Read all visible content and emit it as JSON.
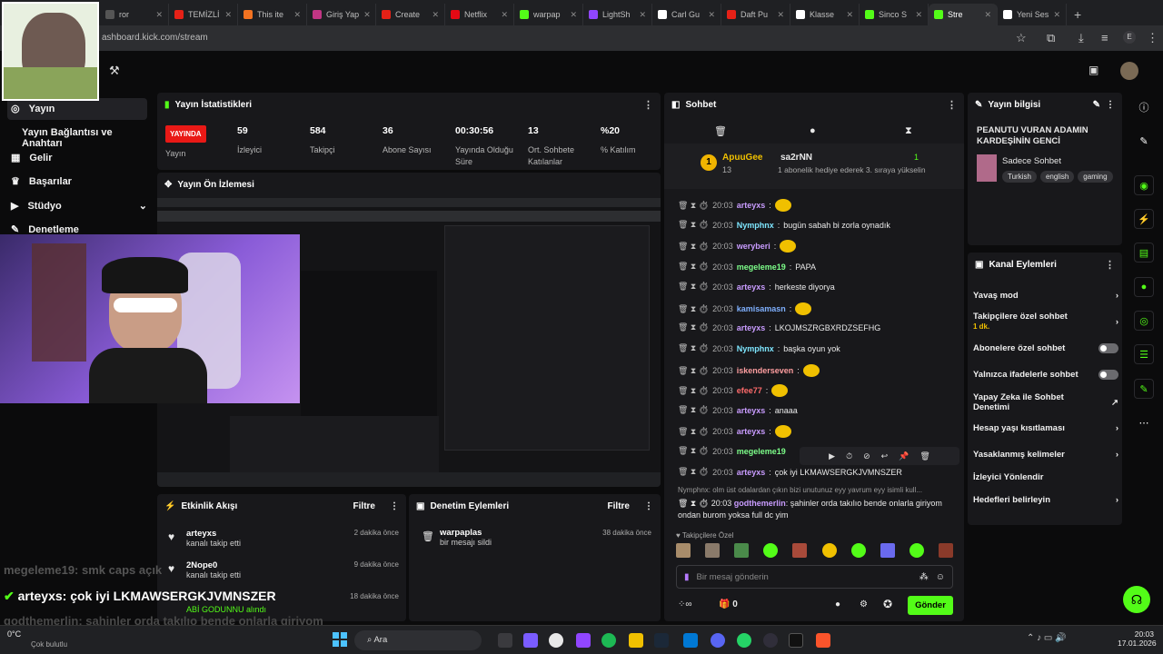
{
  "browser": {
    "tabs": [
      "ror",
      "TEMİZLİ",
      "This ite",
      "Giriş Yap",
      "Create",
      "Netflix",
      "warpap",
      "LightSh",
      "Carl Gu",
      "Daft Pu",
      "Klasse",
      "Sinco S",
      "Stre",
      "Yeni Ses"
    ],
    "url": "ashboard.kick.com/stream"
  },
  "nav": {
    "items": [
      "Yayın",
      "Yayın Bağlantısı ve Anahtarı",
      "Gelir",
      "Başarılar",
      "Stüdyo",
      "Denetleme"
    ]
  },
  "stats": {
    "title": "Yayın İstatistikleri",
    "live": "YAYINDA",
    "status": "Yayın",
    "viewers": "59",
    "viewers_label": "İzleyici",
    "followers": "584",
    "followers_label": "Takipçi",
    "subs": "36",
    "subs_label": "Abone Sayısı",
    "uptime": "00:30:56",
    "uptime_label": "Yayında Olduğu Süre",
    "avg": "13",
    "avg_label": "Ort. Sohbete Katılanlar",
    "pct": "%20",
    "pct_label": "% Katılım"
  },
  "preview": {
    "title": "Yayın Ön İzlemesi"
  },
  "activity": {
    "title": "Etkinlik Akışı",
    "filter": "Filtre",
    "items": [
      {
        "user": "arteyxs",
        "desc": "kanalı takip etti",
        "time": "2 dakika önce"
      },
      {
        "user": "2Nope0",
        "desc": "kanalı takip etti",
        "time": "9 dakika önce"
      },
      {
        "user": "",
        "desc": "ABİ GODUNNU alındı",
        "time": "18 dakika önce"
      }
    ]
  },
  "moderation": {
    "title": "Denetim Eylemleri",
    "filter": "Filtre",
    "user": "warpaplas",
    "desc": "bir mesajı sildi",
    "time": "38 dakika önce"
  },
  "chat": {
    "title": "Sohbet",
    "pinned_user": "ApuuGee",
    "pinned_count": "13",
    "gifter": "sa2rNN",
    "gift_count": "1",
    "gift_msg": "1 abonelik hediye ederek 3. sıraya yükselin",
    "messages": [
      {
        "time": "20:03",
        "user": "arteyxs",
        "text": "",
        "color": "#c99cff"
      },
      {
        "time": "20:03",
        "user": "Nymphnx",
        "text": "bugün sabah bi zorla oynadık",
        "color": "#7ee6ff"
      },
      {
        "time": "20:03",
        "user": "weryberi",
        "text": "",
        "color": "#c99cff"
      },
      {
        "time": "20:03",
        "user": "megeleme19",
        "text": "PAPA",
        "color": "#7dff8a"
      },
      {
        "time": "20:03",
        "user": "arteyxs",
        "text": "herkeste  diyorya",
        "color": "#c99cff"
      },
      {
        "time": "20:03",
        "user": "kamisamasn",
        "text": "",
        "color": "#7fb0ff"
      },
      {
        "time": "20:03",
        "user": "arteyxs",
        "text": "LKOJMSZRGBXRDZSEFHG",
        "color": "#c99cff"
      },
      {
        "time": "20:03",
        "user": "Nymphnx",
        "text": "başka oyun yok",
        "color": "#7ee6ff"
      },
      {
        "time": "20:03",
        "user": "iskenderseven",
        "text": "",
        "color": "#ff9ea0"
      },
      {
        "time": "20:03",
        "user": "efee77",
        "text": "",
        "color": "#ff6b6b"
      },
      {
        "time": "20:03",
        "user": "arteyxs",
        "text": "anaaa",
        "color": "#c99cff"
      },
      {
        "time": "20:03",
        "user": "arteyxs",
        "text": "",
        "color": "#c99cff"
      },
      {
        "time": "20:03",
        "user": "megeleme19",
        "text": "",
        "color": "#7dff8a"
      },
      {
        "time": "20:03",
        "user": "arteyxs",
        "text": "çok iyi LKMAWSERGKJVMNSZER",
        "color": "#c99cff"
      }
    ],
    "reply": "Nymphnx: olm üst odalardan çıkın bizi unutunuz eyy yavrum eyy isimli kull...",
    "last_user": "godthemerlin",
    "last_text": "şahinler orda takılıo bende onlarla giriyom ondan burom yoksa full dc yim",
    "followers_only": "Takipçilere Özel",
    "placeholder": "Bir mesaj gönderin",
    "send": "Gönder",
    "count": "0"
  },
  "info": {
    "title": "Yayın bilgisi",
    "stream_title": "PEANUTU VURAN ADAMIN KARDEŞİNİN GENCİ",
    "category": "Sadece Sohbet",
    "tags": [
      "Turkish",
      "english",
      "gaming"
    ]
  },
  "channel": {
    "title": "Kanal Eylemleri",
    "slow": "Yavaş mod",
    "followers": "Takipçilere özel sohbet",
    "followers_sub": "1 dk.",
    "subs": "Abonelere özel sohbet",
    "emotes": "Yalnızca ifadelerle sohbet",
    "ai": "Yapay Zeka ile Sohbet Denetimi",
    "age": "Hesap yaşı kısıtlaması",
    "banned": "Yasaklanmış kelimeler",
    "redirect": "İzleyici Yönlendir",
    "goals": "Hedefleri belirleyin"
  },
  "overlay": {
    "line1": "megeleme19: smk caps açık",
    "line2": "arteyxs: çok iyi LKMAWSERGKJVMNSZER",
    "line3": "godthemerlin: şahinler orda takılıo bende onlarla giriyom",
    "line4": "burom yoksa full dc yim"
  },
  "taskbar": {
    "weather": "0°C",
    "weather_desc": "Çok bulutlu",
    "search": "Ara",
    "time": "20:03",
    "date": "17.01.2026"
  },
  "colors": {
    "accent": "#53fc18",
    "live": "#e91916"
  }
}
